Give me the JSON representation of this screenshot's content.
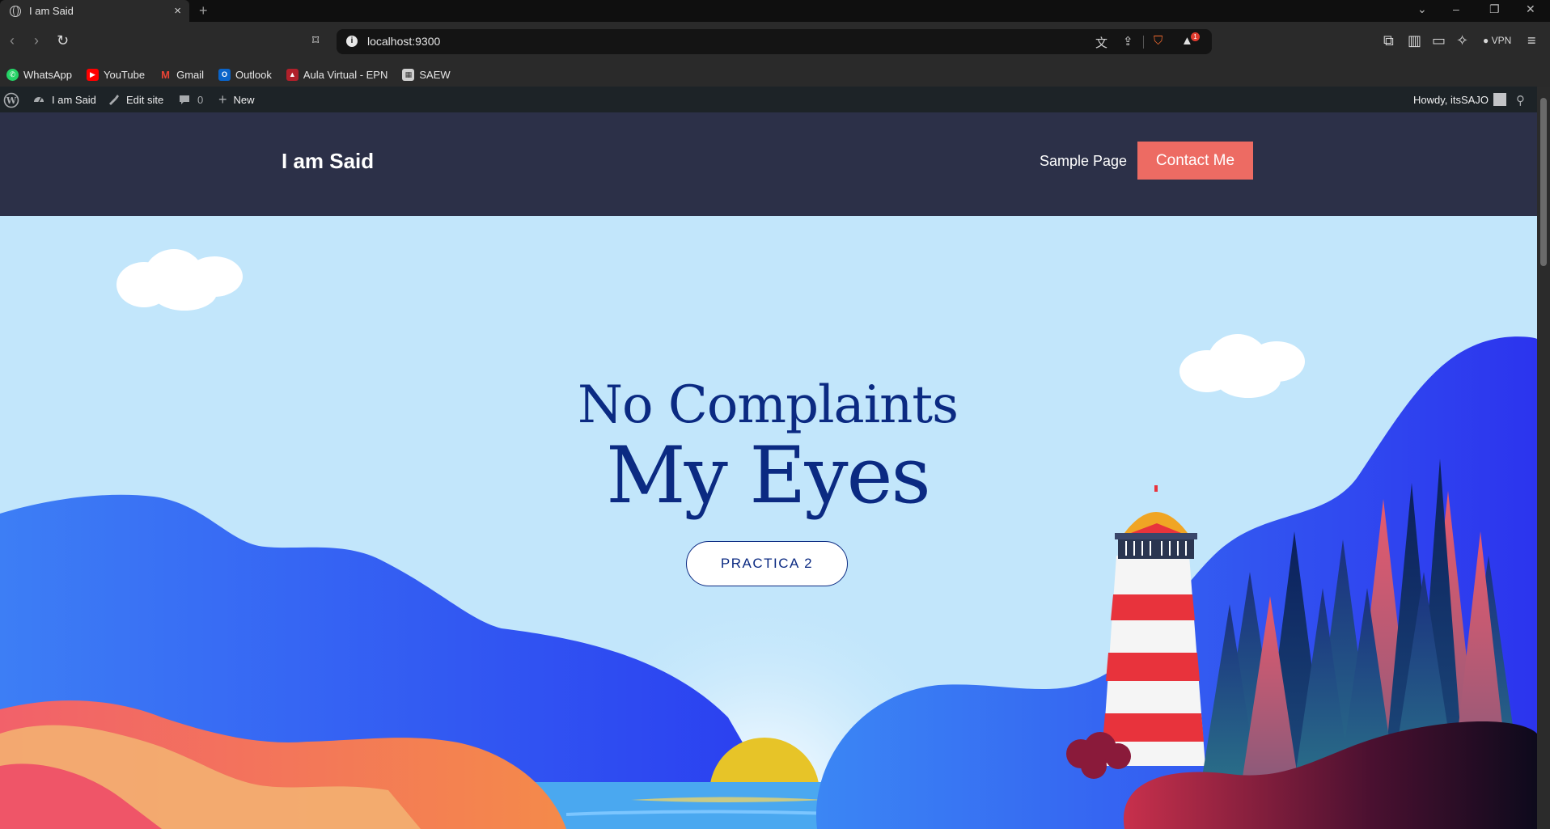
{
  "browser": {
    "tab_title": "I am Said",
    "url": "localhost:9300",
    "vpn_label": "VPN",
    "shield_badge": "1",
    "bookmarks": [
      {
        "label": "WhatsApp",
        "color": "#25d366"
      },
      {
        "label": "YouTube",
        "color": "#ff0000"
      },
      {
        "label": "Gmail",
        "color": "#ea4335"
      },
      {
        "label": "Outlook",
        "color": "#0a64c9"
      },
      {
        "label": "Aula Virtual - EPN",
        "color": "#b0202a"
      },
      {
        "label": "SAEW",
        "color": "#cfcfcf"
      }
    ]
  },
  "admin_bar": {
    "site_name": "I am Said",
    "edit_site": "Edit site",
    "comments_count": "0",
    "new_label": "New",
    "howdy": "Howdy, itsSAJO"
  },
  "site": {
    "title": "I am Said",
    "nav_link": "Sample Page",
    "contact_button": "Contact Me",
    "accent": "#ed6b63",
    "header_bg": "#2c3048"
  },
  "hero": {
    "subtitle": "No Complaints",
    "title": "My Eyes",
    "cta": "PRACTICA 2",
    "text_color": "#0b2a82",
    "sky_color": "#c2e6fb"
  }
}
